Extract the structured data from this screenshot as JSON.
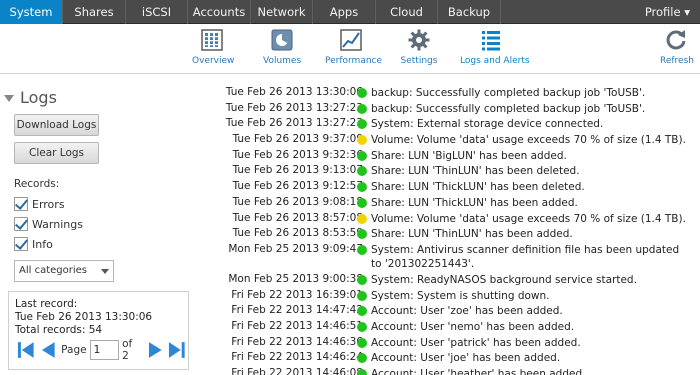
{
  "topnav": {
    "tabs": [
      {
        "label": "System",
        "active": true
      },
      {
        "label": "Shares",
        "active": false
      },
      {
        "label": "iSCSI",
        "active": false
      },
      {
        "label": "Accounts",
        "active": false
      },
      {
        "label": "Network",
        "active": false
      },
      {
        "label": "Apps",
        "active": false
      },
      {
        "label": "Cloud",
        "active": false
      },
      {
        "label": "Backup",
        "active": false
      }
    ],
    "profile_label": "Profile ▾"
  },
  "subnav": {
    "overview": "Overview",
    "volumes": "Volumes",
    "performance": "Performance",
    "settings": "Settings",
    "logs_alerts": "Logs and Alerts",
    "refresh": "Refresh"
  },
  "sidebar": {
    "title": "Logs",
    "download_label": "Download Logs",
    "clear_label": "Clear Logs",
    "records_label": "Records:",
    "checks": {
      "errors": "Errors",
      "warnings": "Warnings",
      "info": "Info"
    },
    "category_selected": "All categories",
    "last_record_label": "Last record:",
    "last_record_value": "Tue Feb 26 2013 13:30:06",
    "total_records": "Total records: 54",
    "page_label": "Page",
    "page_value": "1",
    "page_of": "of 2"
  },
  "colors": {
    "ok": "#22c21f",
    "warn": "#f0d400",
    "accent": "#0a84c6"
  },
  "logs": [
    {
      "ts": "Tue Feb 26 2013 13:30:06",
      "level": "ok",
      "msg": "backup: Successfully completed backup job 'ToUSB'."
    },
    {
      "ts": "Tue Feb 26 2013 13:27:23",
      "level": "ok",
      "msg": "backup: Successfully completed backup job 'ToUSB'."
    },
    {
      "ts": "Tue Feb 26 2013 13:27:23",
      "level": "ok",
      "msg": "System: External storage device connected."
    },
    {
      "ts": "Tue Feb 26 2013 9:37:09",
      "level": "warn",
      "msg": "Volume: Volume 'data' usage exceeds 70 % of size (1.4 TB)."
    },
    {
      "ts": "Tue Feb 26 2013 9:32:36",
      "level": "ok",
      "msg": "Share: LUN 'BigLUN' has been added."
    },
    {
      "ts": "Tue Feb 26 2013 9:13:07",
      "level": "ok",
      "msg": "Share: LUN 'ThinLUN' has been deleted."
    },
    {
      "ts": "Tue Feb 26 2013 9:12:57",
      "level": "ok",
      "msg": "Share: LUN 'ThickLUN' has been deleted."
    },
    {
      "ts": "Tue Feb 26 2013 9:08:18",
      "level": "ok",
      "msg": "Share: LUN 'ThickLUN' has been added."
    },
    {
      "ts": "Tue Feb 26 2013 8:57:08",
      "level": "warn",
      "msg": "Volume: Volume 'data' usage exceeds 70 % of size (1.4 TB)."
    },
    {
      "ts": "Tue Feb 26 2013 8:53:59",
      "level": "ok",
      "msg": "Share: LUN 'ThinLUN' has been added."
    },
    {
      "ts": "Mon Feb 25 2013 9:09:47",
      "level": "ok",
      "msg": "System: Antivirus scanner definition file has been updated to '201302251443'.",
      "tall": true
    },
    {
      "ts": "Mon Feb 25 2013 9:00:38",
      "level": "ok",
      "msg": "System: ReadyNASOS background service started."
    },
    {
      "ts": "Fri Feb 22 2013 16:39:01",
      "level": "ok",
      "msg": "System: System is shutting down."
    },
    {
      "ts": "Fri Feb 22 2013 14:47:42",
      "level": "ok",
      "msg": "Account: User 'zoe' has been added."
    },
    {
      "ts": "Fri Feb 22 2013 14:46:51",
      "level": "ok",
      "msg": "Account: User 'nemo' has been added."
    },
    {
      "ts": "Fri Feb 22 2013 14:46:36",
      "level": "ok",
      "msg": "Account: User 'patrick' has been added."
    },
    {
      "ts": "Fri Feb 22 2013 14:46:24",
      "level": "ok",
      "msg": "Account: User 'joe' has been added."
    },
    {
      "ts": "Fri Feb 22 2013 14:46:08",
      "level": "ok",
      "msg": "Account: User 'heather' has been added."
    }
  ]
}
